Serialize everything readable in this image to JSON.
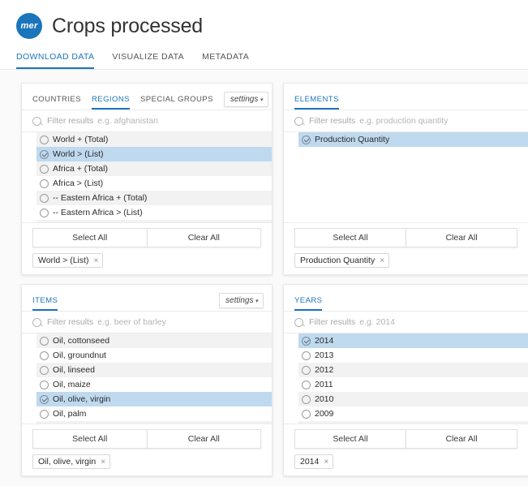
{
  "header": {
    "logo_text": "mer",
    "logo_color": "#1b75bb",
    "title": "Crops processed",
    "tabs": [
      {
        "label": "DOWNLOAD DATA",
        "active": true
      },
      {
        "label": "VISUALIZE DATA",
        "active": false
      },
      {
        "label": "METADATA",
        "active": false
      }
    ]
  },
  "common": {
    "filter_label": "Filter results",
    "select_all_label": "Select All",
    "clear_all_label": "Clear All",
    "settings_label": "settings",
    "caret_glyph": "▾",
    "chip_remove_glyph": "×",
    "accent_color": "#1b75bb",
    "selected_row_color": "#bfd9ef",
    "stripe_color": "#f2f2f2"
  },
  "panels": {
    "countries": {
      "tabs": [
        {
          "label": "COUNTRIES",
          "active": false
        },
        {
          "label": "REGIONS",
          "active": true
        },
        {
          "label": "SPECIAL GROUPS",
          "active": false
        }
      ],
      "has_settings": true,
      "settings_label": "settings",
      "filter_placeholder_example": "e.g. afghanistan",
      "items": [
        {
          "label": "World + (Total)",
          "selected": false
        },
        {
          "label": "World > (List)",
          "selected": true
        },
        {
          "label": "Africa + (Total)",
          "selected": false
        },
        {
          "label": "Africa > (List)",
          "selected": false
        },
        {
          "label": "-- Eastern Africa + (Total)",
          "selected": false
        },
        {
          "label": "-- Eastern Africa > (List)",
          "selected": false
        },
        {
          "label": "",
          "selected": false
        }
      ],
      "chips": [
        "World > (List)"
      ]
    },
    "elements": {
      "tabs": [
        {
          "label": "ELEMENTS",
          "active": true
        }
      ],
      "has_settings": false,
      "filter_placeholder_example": "e.g. production quantity",
      "items": [
        {
          "label": "Production Quantity",
          "selected": true
        }
      ],
      "chips": [
        "Production Quantity"
      ]
    },
    "items": {
      "tabs": [
        {
          "label": "ITEMS",
          "active": true
        }
      ],
      "has_settings": true,
      "settings_label": "settings",
      "filter_placeholder_example": "e.g. beer of barley",
      "items": [
        {
          "label": "Oil, cottonseed",
          "selected": false
        },
        {
          "label": "Oil, groundnut",
          "selected": false
        },
        {
          "label": "Oil, linseed",
          "selected": false
        },
        {
          "label": "Oil, maize",
          "selected": false
        },
        {
          "label": "Oil, olive, virgin",
          "selected": true
        },
        {
          "label": "Oil, palm",
          "selected": false
        },
        {
          "label": "",
          "selected": false
        }
      ],
      "chips": [
        "Oil, olive, virgin"
      ]
    },
    "years": {
      "tabs": [
        {
          "label": "YEARS",
          "active": true
        }
      ],
      "has_settings": false,
      "filter_placeholder_example": "e.g. 2014",
      "items": [
        {
          "label": "2014",
          "selected": true
        },
        {
          "label": "2013",
          "selected": false
        },
        {
          "label": "2012",
          "selected": false
        },
        {
          "label": "2011",
          "selected": false
        },
        {
          "label": "2010",
          "selected": false
        },
        {
          "label": "2009",
          "selected": false
        },
        {
          "label": "",
          "selected": false
        }
      ],
      "chips": [
        "2014"
      ]
    }
  }
}
